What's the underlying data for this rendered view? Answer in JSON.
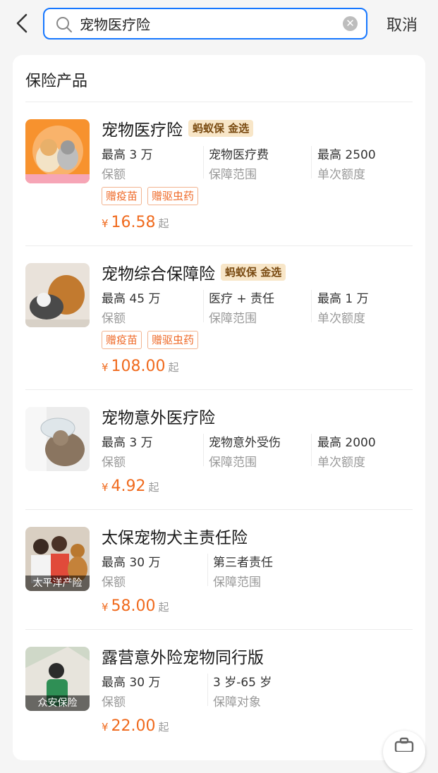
{
  "header": {
    "search_value": "宠物医疗险",
    "cancel_label": "取消"
  },
  "section": {
    "title": "保险产品"
  },
  "products": [
    {
      "name": "宠物医疗险",
      "badge": "蚂蚁保 金选",
      "attrs": [
        {
          "value": "最高 3 万",
          "label": "保额"
        },
        {
          "value": "宠物医疗费",
          "label": "保障范围"
        },
        {
          "value": "最高 2500",
          "label": "单次额度"
        }
      ],
      "tags": [
        "赠疫苗",
        "赠驱虫药"
      ],
      "currency": "¥",
      "price": "16.58",
      "price_suffix": "起"
    },
    {
      "name": "宠物综合保障险",
      "badge": "蚂蚁保 金选",
      "attrs": [
        {
          "value": "最高 45 万",
          "label": "保额"
        },
        {
          "value": "医疗 + 责任",
          "label": "保障范围"
        },
        {
          "value": "最高 1 万",
          "label": "单次额度"
        }
      ],
      "tags": [
        "赠疫苗",
        "赠驱虫药"
      ],
      "currency": "¥",
      "price": "108.00",
      "price_suffix": "起"
    },
    {
      "name": "宠物意外医疗险",
      "attrs": [
        {
          "value": "最高 3 万",
          "label": "保额"
        },
        {
          "value": "宠物意外受伤",
          "label": "保障范围"
        },
        {
          "value": "最高 2000",
          "label": "单次额度"
        }
      ],
      "currency": "¥",
      "price": "4.92",
      "price_suffix": "起"
    },
    {
      "name": "太保宠物犬主责任险",
      "image_caption": "太平洋产险",
      "attrs": [
        {
          "value": "最高 30 万",
          "label": "保额"
        },
        {
          "value": "第三者责任",
          "label": "保障范围"
        }
      ],
      "currency": "¥",
      "price": "58.00",
      "price_suffix": "起"
    },
    {
      "name": "露营意外险宠物同行版",
      "image_caption": "众安保险",
      "attrs": [
        {
          "value": "最高 30 万",
          "label": "保额"
        },
        {
          "value": "3 岁-65 岁",
          "label": "保障对象"
        }
      ],
      "currency": "¥",
      "price": "22.00",
      "price_suffix": "起"
    }
  ],
  "colors": {
    "accent": "#1677ff",
    "price": "#f06a1d",
    "badge_bg": "#f8e6c8",
    "tag": "#ef6b2a"
  },
  "icons": [
    "back-arrow-icon",
    "search-icon",
    "clear-icon",
    "briefcase-icon"
  ]
}
